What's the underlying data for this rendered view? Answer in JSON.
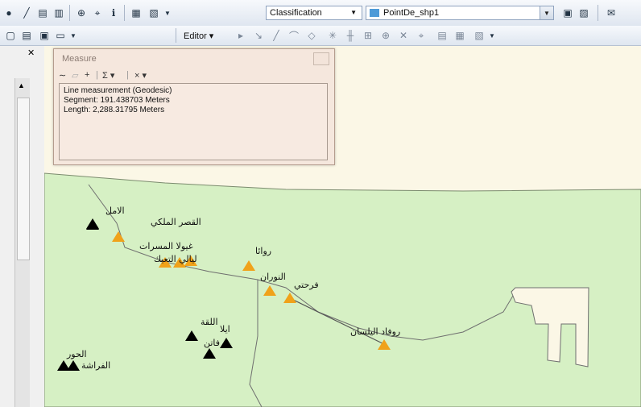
{
  "toolbar": {
    "layer_combo_value": "Classification",
    "target_combo_value": "PointDe_shp1",
    "editor_label": "Editor"
  },
  "measure_window": {
    "title": "Measure",
    "result_lines": [
      "Line measurement (Geodesic)",
      "Segment: 191.438703 Meters",
      "Length: 2,288.31795 Meters"
    ]
  },
  "map": {
    "land_color": "#d6f0c4",
    "background_color": "#fbf7e6",
    "points": [
      {
        "type": "black",
        "label": "الامل"
      },
      {
        "type": "orange",
        "label": "القصر الملكي"
      },
      {
        "type": "orange",
        "label": "غيولا المسرات"
      },
      {
        "type": "orange",
        "label": "ليالي التعيك"
      },
      {
        "type": "orange",
        "label": "روائا"
      },
      {
        "type": "orange",
        "label": "النوران"
      },
      {
        "type": "orange",
        "label": "فرحتي"
      },
      {
        "type": "orange",
        "label": "روفاد اليلسان"
      },
      {
        "type": "black",
        "label": "اللقة"
      },
      {
        "type": "black",
        "label": "ايلا"
      },
      {
        "type": "black",
        "label": "فاتن"
      },
      {
        "type": "black",
        "label": "الحور"
      },
      {
        "type": "black",
        "label": "الفراشة"
      }
    ]
  }
}
